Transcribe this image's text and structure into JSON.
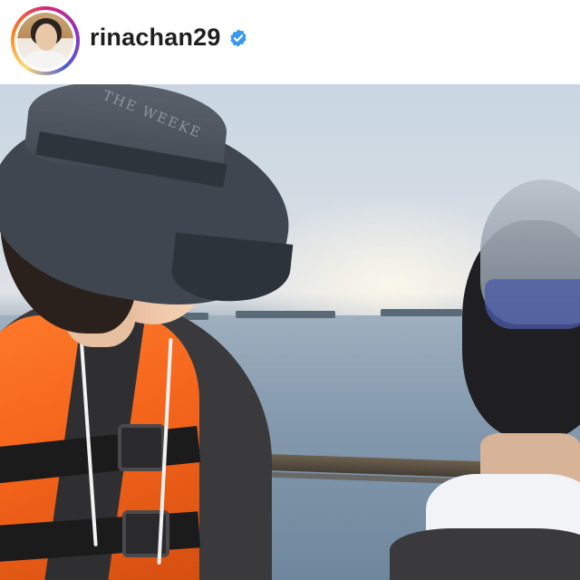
{
  "post_header": {
    "username": "rinachan29",
    "verified_icon": "verified-badge-icon",
    "avatar": "profile-avatar",
    "accent_color": "#3897f0"
  },
  "photo": {
    "hat_text": "THE WEEKE"
  }
}
